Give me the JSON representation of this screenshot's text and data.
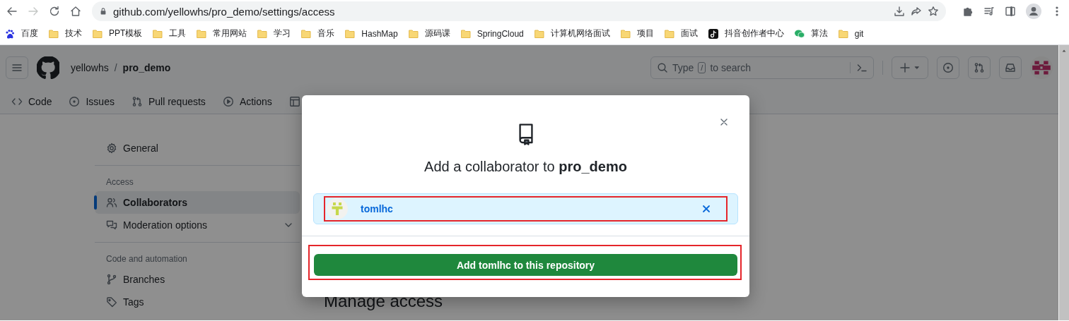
{
  "browser": {
    "back_enabled": true,
    "forward_enabled": false,
    "url": "github.com/yellowhs/pro_demo/settings/access",
    "bookmarks": [
      {
        "label": "百度",
        "kind": "paw"
      },
      {
        "label": "技术",
        "kind": "folder"
      },
      {
        "label": "PPT模板",
        "kind": "folder"
      },
      {
        "label": "工具",
        "kind": "folder"
      },
      {
        "label": "常用网站",
        "kind": "folder"
      },
      {
        "label": "学习",
        "kind": "folder"
      },
      {
        "label": "音乐",
        "kind": "folder"
      },
      {
        "label": "HashMap",
        "kind": "folder"
      },
      {
        "label": "源码课",
        "kind": "folder"
      },
      {
        "label": "SpringCloud",
        "kind": "folder"
      },
      {
        "label": "计算机网络面试",
        "kind": "folder"
      },
      {
        "label": "项目",
        "kind": "folder"
      },
      {
        "label": "面试",
        "kind": "folder"
      },
      {
        "label": "抖音创作者中心",
        "kind": "note"
      },
      {
        "label": "算法",
        "kind": "chat"
      },
      {
        "label": "git",
        "kind": "folder"
      }
    ]
  },
  "header": {
    "owner": "yellowhs",
    "separator": "/",
    "repo": "pro_demo",
    "search": {
      "placeholder_start": "Type",
      "shortcut_key": "/",
      "placeholder_end": "to search"
    }
  },
  "repo_tabs": [
    {
      "label": "Code",
      "kind": "code"
    },
    {
      "label": "Issues",
      "kind": "issue"
    },
    {
      "label": "Pull requests",
      "kind": "pull"
    },
    {
      "label": "Actions",
      "kind": "play"
    },
    {
      "kind": "table"
    }
  ],
  "sidebar": [
    {
      "items": [
        {
          "label": "General",
          "kind": "gear",
          "selected": false
        }
      ]
    },
    {
      "heading": "Access",
      "items": [
        {
          "label": "Collaborators",
          "kind": "people",
          "selected": true
        },
        {
          "label": "Moderation options",
          "kind": "comment",
          "selected": false,
          "expanded": false
        }
      ]
    },
    {
      "heading": "Code and automation",
      "items": [
        {
          "label": "Branches",
          "kind": "branch",
          "selected": false
        },
        {
          "label": "Tags",
          "kind": "tag",
          "selected": false
        }
      ]
    }
  ],
  "main_heading": "Manage access",
  "dialog": {
    "title": "Add a collaborator to **pro_demo**",
    "selected_user": {
      "name": "tomlhc"
    },
    "submit_button": "Add tomlhc to this repository"
  }
}
